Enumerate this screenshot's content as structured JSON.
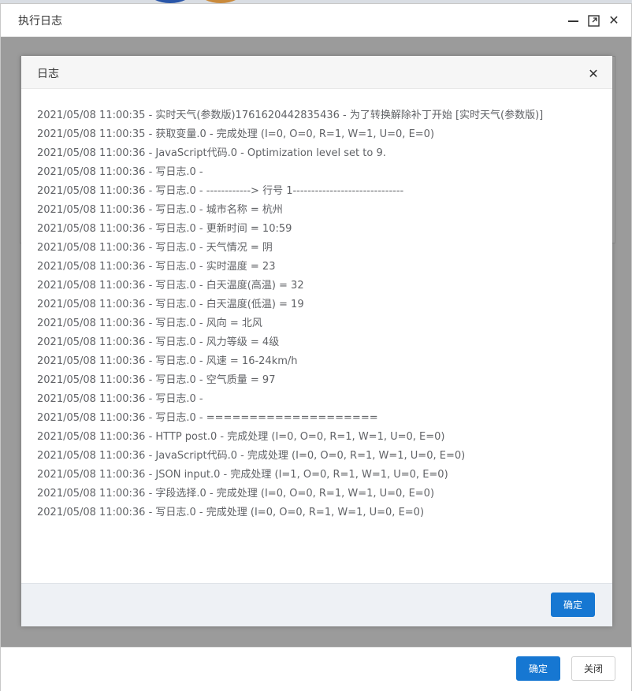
{
  "outer_window": {
    "title": "执行日志",
    "ok_label": "确定",
    "close_label": "关闭",
    "controls": {
      "minimize_icon": "minimize-icon",
      "maximize_icon": "maximize-icon",
      "close_icon": "close-icon",
      "close_glyph": "✕"
    }
  },
  "dialog": {
    "title": "日志",
    "close_glyph": "✕",
    "ok_label": "确定",
    "log_lines": [
      "2021/05/08 11:00:35 - 实时天气(参数版)1761620442835436 - 为了转换解除补丁开始 [实时天气(参数版)]",
      "2021/05/08 11:00:35 - 获取变量.0 - 完成处理 (I=0, O=0, R=1, W=1, U=0, E=0)",
      "2021/05/08 11:00:36 - JavaScript代码.0 - Optimization level set to 9.",
      "2021/05/08 11:00:36 - 写日志.0 -",
      "2021/05/08 11:00:36 - 写日志.0 - ------------> 行号 1------------------------------",
      "2021/05/08 11:00:36 - 写日志.0 - 城市名称 = 杭州",
      "2021/05/08 11:00:36 - 写日志.0 - 更新时间 = 10:59",
      "2021/05/08 11:00:36 - 写日志.0 - 天气情况 = 阴",
      "2021/05/08 11:00:36 - 写日志.0 - 实时温度 = 23",
      "2021/05/08 11:00:36 - 写日志.0 - 白天温度(高温) = 32",
      "2021/05/08 11:00:36 - 写日志.0 - 白天温度(低温) = 19",
      "2021/05/08 11:00:36 - 写日志.0 - 风向 = 北风",
      "2021/05/08 11:00:36 - 写日志.0 - 风力等级 = 4级",
      "2021/05/08 11:00:36 - 写日志.0 - 风速 = 16-24km/h",
      "2021/05/08 11:00:36 - 写日志.0 - 空气质量 = 97",
      "2021/05/08 11:00:36 - 写日志.0 -",
      "2021/05/08 11:00:36 - 写日志.0 - ====================",
      "2021/05/08 11:00:36 - HTTP post.0 - 完成处理 (I=0, O=0, R=1, W=1, U=0, E=0)",
      "2021/05/08 11:00:36 - JavaScript代码.0 - 完成处理 (I=0, O=0, R=1, W=1, U=0, E=0)",
      "2021/05/08 11:00:36 - JSON input.0 - 完成处理 (I=1, O=0, R=1, W=1, U=0, E=0)",
      "2021/05/08 11:00:36 - 字段选择.0 - 完成处理 (I=0, O=0, R=1, W=1, U=0, E=0)",
      "2021/05/08 11:00:36 - 写日志.0 - 完成处理 (I=0, O=0, R=1, W=1, U=0, E=0)"
    ]
  },
  "colors": {
    "primary_button": "#1677d2",
    "log_text": "#606266",
    "overlay": "#9e9e9e"
  }
}
